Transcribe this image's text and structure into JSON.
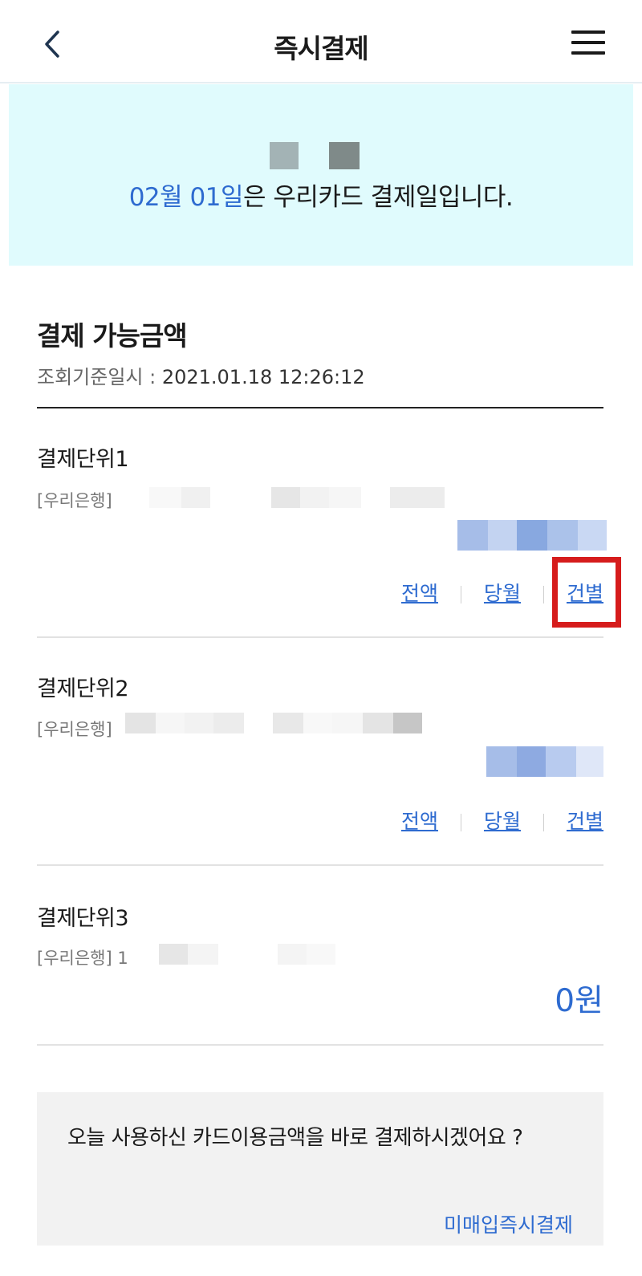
{
  "header": {
    "title": "즉시결제"
  },
  "banner": {
    "date_highlight": "02월 01일",
    "message": "은 우리카드 결제일입니다."
  },
  "summary": {
    "title": "결제 가능금액",
    "timestamp_label": "조회기준일시 : ",
    "timestamp_value": "2021.01.18 12:26:12"
  },
  "units": [
    {
      "title": "결제단위1",
      "bank": "[우리은행]",
      "links": [
        "전액",
        "당월",
        "건별"
      ]
    },
    {
      "title": "결제단위2",
      "bank": "[우리은행]",
      "links": [
        "전액",
        "당월",
        "건별"
      ]
    },
    {
      "title": "결제단위3",
      "bank": "[우리은행] 1",
      "amount": "0원"
    }
  ],
  "prompt": {
    "text": "오늘 사용하신 카드이용금액을 바로 결제하시겠어요 ?",
    "link": "미매입즉시결제"
  },
  "colors": {
    "accent": "#2e6bd0",
    "banner_bg": "#e0fbfd",
    "highlight": "#d61c1c"
  }
}
